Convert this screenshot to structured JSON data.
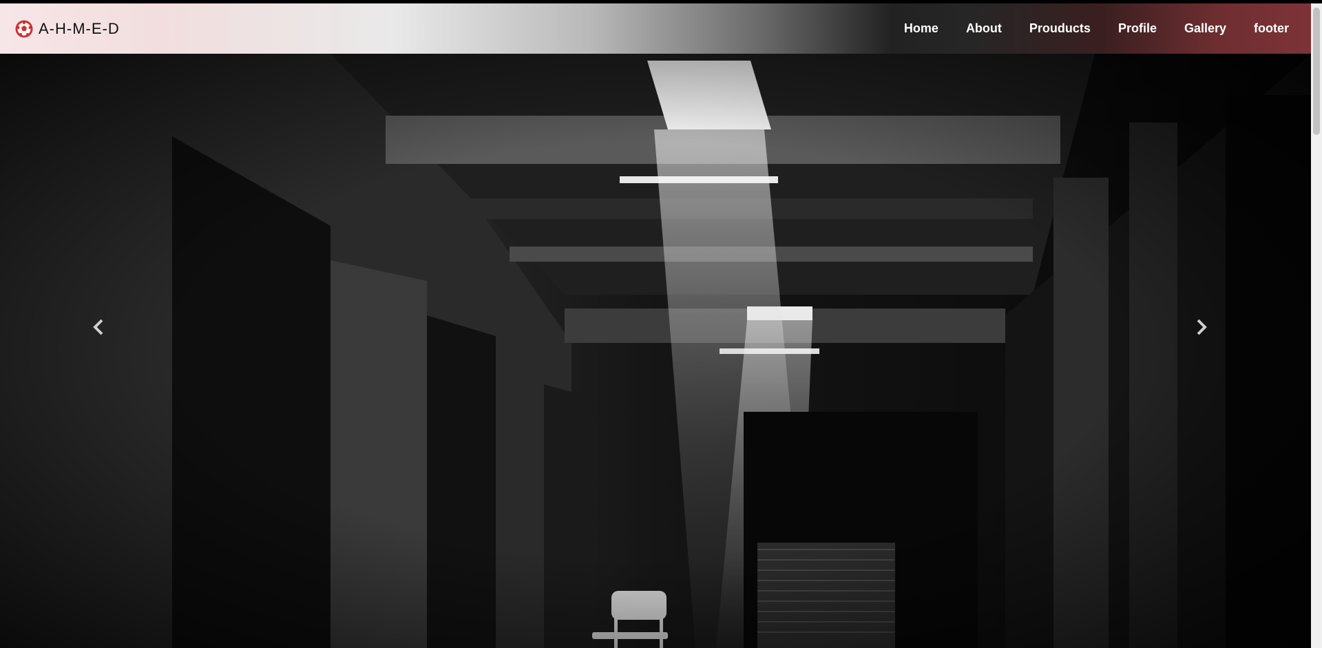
{
  "brand": {
    "name": "A-H-M-E-D",
    "icon": "soccer-ball-icon",
    "icon_color": "#d32f2f"
  },
  "nav": {
    "items": [
      "Home",
      "About",
      "Prouducts",
      "Profile",
      "Gallery",
      "footer"
    ]
  },
  "carousel": {
    "prev_icon": "chevron-left-icon",
    "next_icon": "chevron-right-icon"
  },
  "colors": {
    "nav_right": "#7d3337",
    "nav_left": "#f2dede"
  }
}
